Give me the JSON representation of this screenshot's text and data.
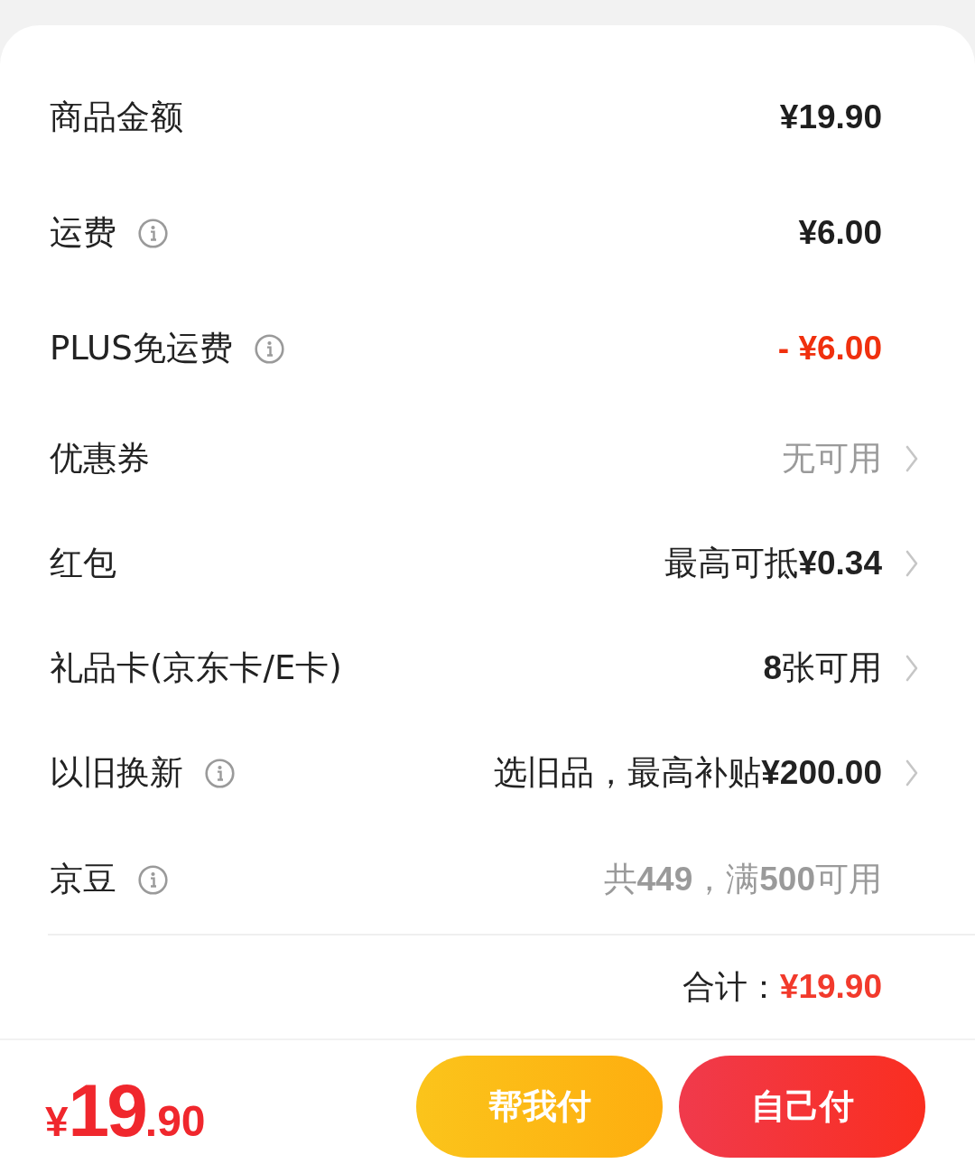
{
  "fees": [
    {
      "label": "商品金额",
      "info": false,
      "value": "¥19.90",
      "kind": "amount",
      "chevron": false
    },
    {
      "label": "运费",
      "info": true,
      "value": "¥6.00",
      "kind": "amount",
      "chevron": false
    },
    {
      "label": "PLUS免运费",
      "info": true,
      "value": "- ¥6.00",
      "kind": "discount",
      "chevron": false
    },
    {
      "label": "优惠券",
      "info": false,
      "value": "无可用",
      "kind": "muted",
      "chevron": true
    },
    {
      "label": "红包",
      "info": false,
      "value": "最高可抵**¥0.34**",
      "kind": "plain",
      "chevron": true
    },
    {
      "label": "礼品卡(京东卡/E卡)",
      "info": false,
      "value": "**8**张可用",
      "kind": "plain",
      "chevron": true
    },
    {
      "label": "以旧换新",
      "info": true,
      "value": "选旧品，最高补贴**¥200.00**",
      "kind": "plain",
      "chevron": true
    },
    {
      "label": "京豆",
      "info": true,
      "value": "共**449**，满**500**可用",
      "kind": "muted",
      "chevron": false
    }
  ],
  "total": {
    "label": "合计：",
    "amount": "¥19.90"
  },
  "pay_bar": {
    "price": {
      "currency": "¥",
      "integer": "19",
      "fraction": ".90"
    },
    "buttons": [
      {
        "label": "帮我付",
        "kind": "friend"
      },
      {
        "label": "自己付",
        "kind": "self"
      }
    ]
  }
}
